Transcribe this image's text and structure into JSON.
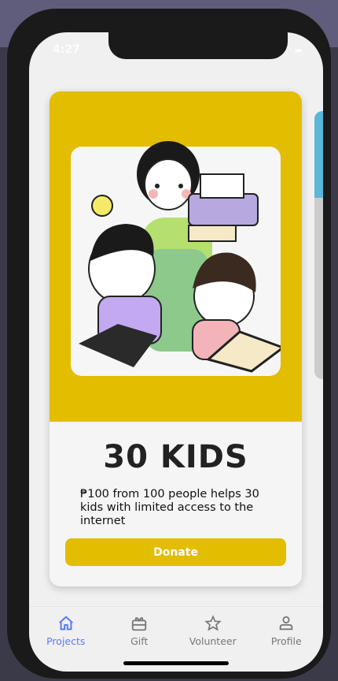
{
  "status_bar": {
    "time": "4:27"
  },
  "project": {
    "title": "30 KIDS",
    "description": "₱100 from 100 people helps 30 kids with limited access to the internet",
    "donate_label": "Donate",
    "hero_color": "#e2bd00"
  },
  "tabs": [
    {
      "label": "Projects",
      "icon": "home-icon",
      "active": true
    },
    {
      "label": "Gift",
      "icon": "gift-icon",
      "active": false
    },
    {
      "label": "Volunteer",
      "icon": "star-icon",
      "active": false
    },
    {
      "label": "Profile",
      "icon": "person-icon",
      "active": false
    }
  ],
  "colors": {
    "accent": "#5a7cf0",
    "inactive": "#777777"
  }
}
